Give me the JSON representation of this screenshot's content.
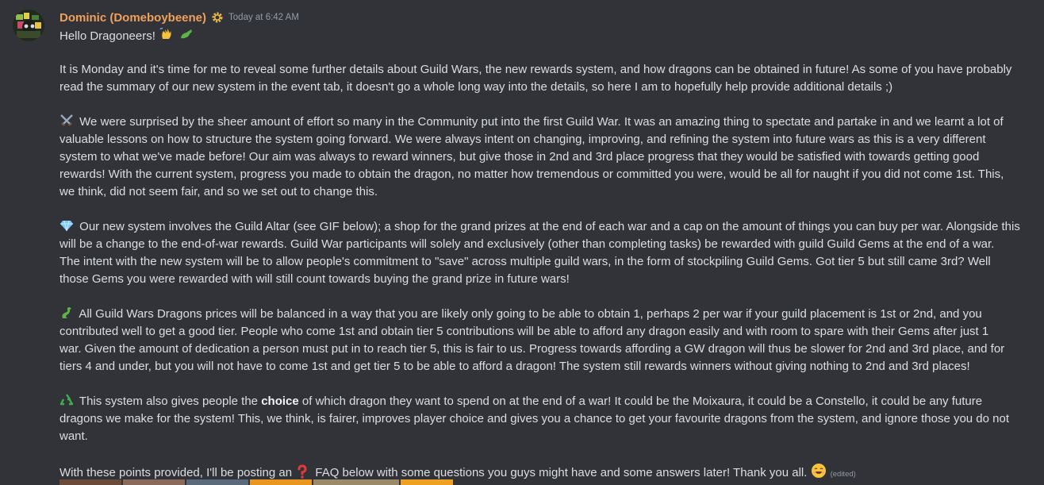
{
  "message": {
    "author": "Dominic (Domeboybeene)",
    "timestamp": "Today at 6:42 AM",
    "role_icon": "gear-icon",
    "edited_label": "(edited)",
    "lines": {
      "l1": "Hello Dragoneers!",
      "p1a": "It is Monday and it's time for me to reveal some further details about Guild Wars, the new rewards system, and how dragons can be obtained in future! As some of you have probably",
      "p1b": "read the summary of our new system in the event tab, it doesn't go a whole long way into the details, so here I am to hopefully help provide additional details ;)",
      "p2a": "We were surprised by the sheer amount of effort so many in the Community put into the first Guild War. It was an amazing thing to spectate and partake in and we learnt a lot of",
      "p2b": "valuable lessons on how to structure the system going forward. We were always intent on changing, improving, and refining the system into future wars as this is a very different",
      "p2c": "system to what we've made before! Our aim was always to reward winners, but give those in 2nd and 3rd place progress that they would be satisfied with towards getting good",
      "p2d": "rewards! With the current system, progress you made to obtain the dragon, no matter how tremendous or committed you were, would be all for naught if you did not come 1st. This,",
      "p2e": "we think, did not seem fair, and so we set out to change this.",
      "p3a": "Our new system involves the Guild Altar (see GIF below); a shop for the grand prizes at the end of each war and a cap on the amount of things you can buy per war. Alongside this",
      "p3b": "will be a change to the end-of-war rewards. Guild War participants will solely and exclusively (other than completing tasks) be rewarded with guild Guild Gems at the end of a war.",
      "p3c": "The intent with the new system will be to allow people's commitment to \"save\" across multiple guild wars, in the form of stockpiling Guild Gems. Got tier 5 but still came 3rd? Well",
      "p3d": "those Gems you were rewarded with will still count towards buying the grand prize in future wars!",
      "p4a": "All Guild Wars Dragons prices will be balanced in a way that you are likely only going to be able to obtain 1, perhaps 2 per war if your guild placement is 1st or 2nd, and you",
      "p4b": "contributed well to get a good tier. People who come 1st and obtain tier 5 contributions will be able to afford any dragon easily and with room to spare with their Gems after just 1",
      "p4c": "war. Given the amount of dedication a person must put in to reach tier 5, this is fair to us. Progress towards affording a GW dragon will thus be slower for 2nd and 3rd place, and for",
      "p4d": "tiers 4 and under, but you will not have to come 1st and get tier 5 to be able to afford a dragon! The system still rewards winners without giving nothing to 2nd and 3rd places!",
      "p5a_pre": "This system also gives people the ",
      "p5a_bold": "choice",
      "p5a_post": " of which dragon they want to spend on at the end of a war! It could be the Moixaura, it could be a Constello, it could be any future",
      "p5b": "dragons we make for the system! This, we think, is fairer, improves player choice and gives you a chance to get your favourite dragons from the system, and ignore those you do not",
      "p5c": "want.",
      "p6_pre": "With these points provided, I'll be posting an ",
      "p6_post": " FAQ below with some questions you guys might have and some answers later! Thank you all."
    },
    "emoji": [
      "wave-emoji",
      "dragon-emoji",
      "crossed-swords-emoji",
      "gem-emoji",
      "dragon-emoji",
      "recycle-emoji",
      "question-emoji",
      "smile-emoji"
    ]
  },
  "colors": {
    "background": "#313338",
    "username": "#f0a05a",
    "text": "#dbdee1",
    "muted": "#949ba4"
  }
}
